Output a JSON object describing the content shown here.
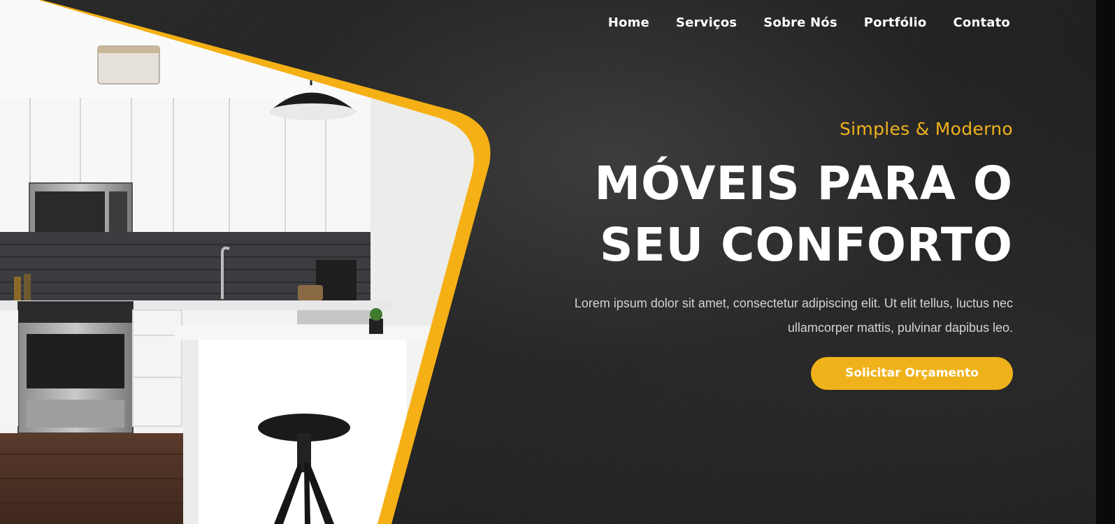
{
  "nav": {
    "items": [
      "Home",
      "Serviços",
      "Sobre Nós",
      "Portfólio",
      "Contato"
    ]
  },
  "hero": {
    "tagline": "Simples & Moderno",
    "headline_line1": "MÓVEIS PARA O",
    "headline_line2": "SEU CONFORTO",
    "description": "Lorem ipsum dolor sit amet, consectetur adipiscing elit. Ut elit tellus, luctus nec ullamcorper mattis, pulvinar dapibus leo.",
    "cta_label": "Solicitar Orçamento"
  },
  "colors": {
    "accent": "#f0b21b",
    "background": "#151515",
    "text": "#ffffff"
  },
  "images": {
    "hero_photo": "kitchen-photo"
  }
}
